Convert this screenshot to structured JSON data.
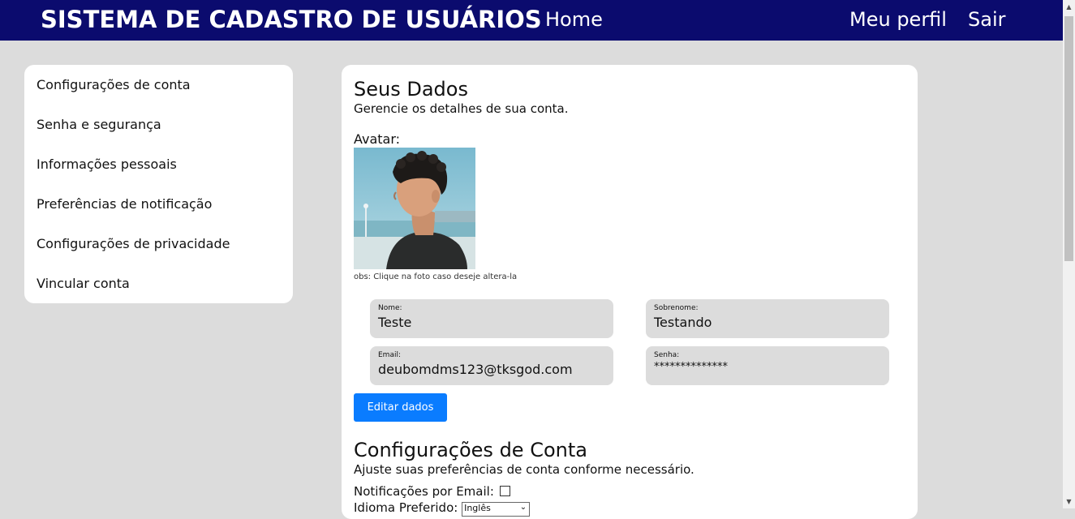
{
  "header": {
    "brand": "SISTEMA DE CADASTRO DE USUÁRIOS",
    "nav_home": "Home",
    "nav_profile": "Meu perfil",
    "nav_logout": "Sair"
  },
  "sidebar": {
    "items": [
      {
        "label": "Configurações de conta"
      },
      {
        "label": "Senha e segurança"
      },
      {
        "label": "Informações pessoais"
      },
      {
        "label": "Preferências de notificação"
      },
      {
        "label": "Configurações de privacidade"
      },
      {
        "label": "Vincular conta"
      }
    ]
  },
  "profile": {
    "title": "Seus Dados",
    "subtitle": "Gerencie os detalhes de sua conta.",
    "avatar_label": "Avatar:",
    "avatar_hint": "obs: Clique na foto caso deseje altera-la",
    "fields": {
      "nome": {
        "label": "Nome:",
        "value": "Teste"
      },
      "sobrenome": {
        "label": "Sobrenome:",
        "value": "Testando"
      },
      "email": {
        "label": "Email:",
        "value": "deubomdms123@tksgod.com"
      },
      "senha": {
        "label": "Senha:",
        "value": "**************"
      }
    },
    "edit_button": "Editar dados"
  },
  "account_settings": {
    "title": "Configurações de Conta",
    "subtitle": "Ajuste suas preferências de conta conforme necessário.",
    "email_notifications_label": "Notificações por Email:",
    "email_notifications_checked": false,
    "language_label": "Idioma Preferido:",
    "language_value": "Inglês"
  },
  "colors": {
    "header_bg": "#0b0b6e",
    "page_bg": "#dcdcdc",
    "accent": "#0a7cff"
  }
}
